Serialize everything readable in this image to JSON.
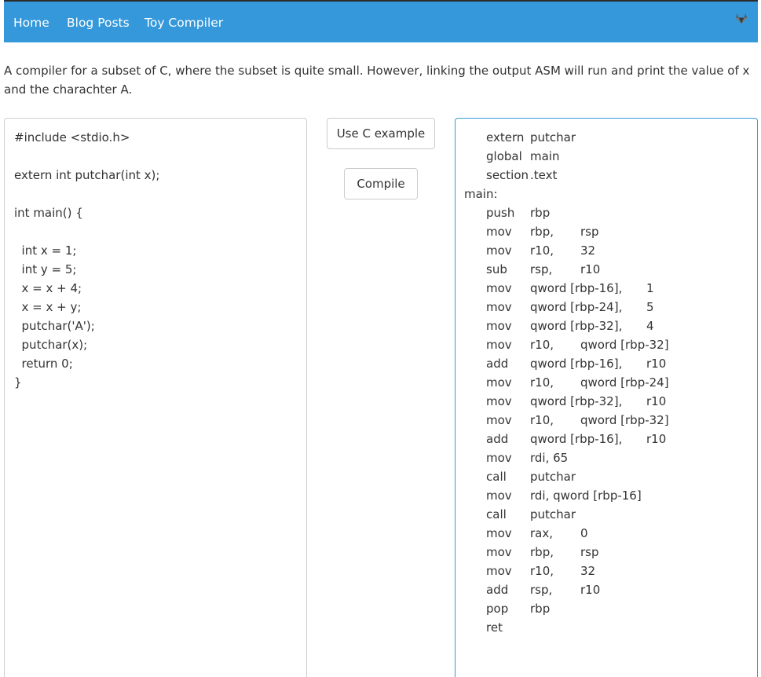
{
  "nav": {
    "links": [
      "Home",
      "Blog Posts",
      "Toy Compiler"
    ],
    "right_icon": "gitlab-fox-icon"
  },
  "intro_text": "A compiler for a subset of C, where the subset is quite small. However, linking the output ASM will run and print the value of x and the charachter A.",
  "buttons": {
    "example_label": "Use C example",
    "compile_label": "Compile"
  },
  "source_lines": [
    "#include <stdio.h>",
    "",
    "extern int putchar(int x);",
    "",
    "int main() {",
    "",
    "  int x = 1;",
    "  int y = 5;",
    "  x = x + 4;",
    "  x = x + y;",
    "  putchar('A');",
    "  putchar(x);",
    "  return 0;",
    "}"
  ],
  "asm_lines": [
    {
      "label": "",
      "op": "extern",
      "a1": "putchar",
      "a2": ""
    },
    {
      "label": "",
      "op": "global",
      "a1": "main",
      "a2": ""
    },
    {
      "label": "",
      "op": "section",
      "a1": ".text",
      "a2": ""
    },
    {
      "label": "main:",
      "op": "",
      "a1": "",
      "a2": ""
    },
    {
      "label": "",
      "op": "push",
      "a1": "rbp",
      "a2": ""
    },
    {
      "label": "",
      "op": "mov",
      "a1": "rbp,",
      "a2": "rsp"
    },
    {
      "label": "",
      "op": "mov",
      "a1": "r10,",
      "a2": "32"
    },
    {
      "label": "",
      "op": "sub",
      "a1": "rsp,",
      "a2": "r10"
    },
    {
      "label": "",
      "op": "mov",
      "a1": "qword [rbp-16],",
      "a2": "1"
    },
    {
      "label": "",
      "op": "mov",
      "a1": "qword [rbp-24],",
      "a2": "5"
    },
    {
      "label": "",
      "op": "mov",
      "a1": "qword [rbp-32],",
      "a2": "4"
    },
    {
      "label": "",
      "op": "mov",
      "a1": "r10,",
      "a2": "qword [rbp-32]"
    },
    {
      "label": "",
      "op": "add",
      "a1": "qword [rbp-16],",
      "a2": "r10"
    },
    {
      "label": "",
      "op": "mov",
      "a1": "r10,",
      "a2": "qword [rbp-24]"
    },
    {
      "label": "",
      "op": "mov",
      "a1": "qword [rbp-32],",
      "a2": "r10"
    },
    {
      "label": "",
      "op": "mov",
      "a1": "r10,",
      "a2": "qword [rbp-32]"
    },
    {
      "label": "",
      "op": "add",
      "a1": "qword [rbp-16],",
      "a2": "r10"
    },
    {
      "label": "",
      "op": "mov",
      "a1": "rdi, 65",
      "a2": ""
    },
    {
      "label": "",
      "op": "call",
      "a1": "putchar",
      "a2": ""
    },
    {
      "label": "",
      "op": "mov",
      "a1": "rdi, qword [rbp-16]",
      "a2": ""
    },
    {
      "label": "",
      "op": "call",
      "a1": "putchar",
      "a2": ""
    },
    {
      "label": "",
      "op": "mov",
      "a1": "rax,",
      "a2": "0"
    },
    {
      "label": "",
      "op": "mov",
      "a1": "rbp,",
      "a2": "rsp"
    },
    {
      "label": "",
      "op": "mov",
      "a1": "r10,",
      "a2": "32"
    },
    {
      "label": "",
      "op": "add",
      "a1": "rsp,",
      "a2": "r10"
    },
    {
      "label": "",
      "op": "pop",
      "a1": "rbp",
      "a2": ""
    },
    {
      "label": "",
      "op": "ret",
      "a1": "",
      "a2": ""
    }
  ],
  "colors": {
    "navbar": "#3498db",
    "output_border": "#3498db",
    "text": "#333333"
  }
}
